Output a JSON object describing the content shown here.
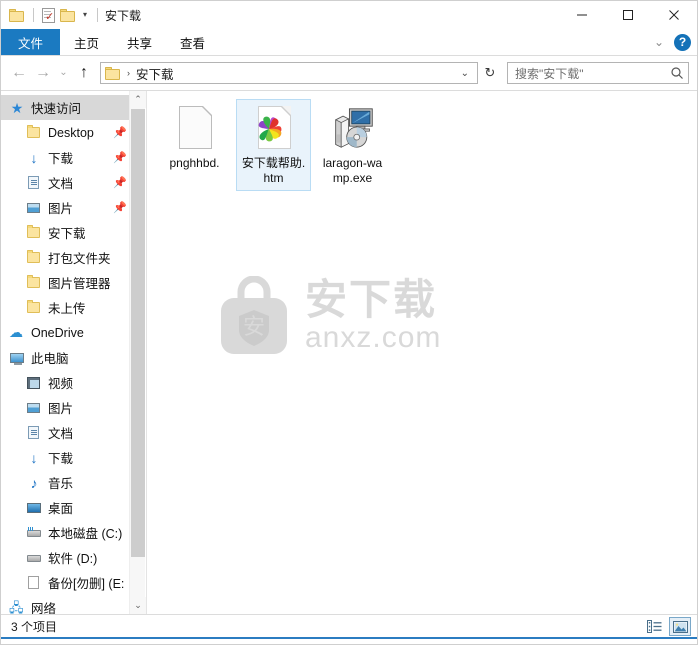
{
  "window": {
    "title": "安下载",
    "quick_access_toolbar": [
      {
        "name": "folder-icon",
        "label": "属性"
      },
      {
        "name": "properties-icon",
        "label": "属性"
      },
      {
        "name": "new-folder-icon",
        "label": "新建文件夹"
      },
      {
        "name": "customize-caret-icon",
        "label": "▾"
      }
    ],
    "controls": {
      "minimize": "—",
      "maximize": "□",
      "close": "✕"
    }
  },
  "ribbon": {
    "tabs": [
      {
        "label": "文件",
        "active": true
      },
      {
        "label": "主页",
        "active": false
      },
      {
        "label": "共享",
        "active": false
      },
      {
        "label": "查看",
        "active": false
      }
    ],
    "collapse_icon": "chevron-down",
    "help_label": "?"
  },
  "navbar": {
    "back_icon": "←",
    "forward_icon": "→",
    "history_icon": "⌄",
    "up_icon": "↑",
    "address": {
      "crumb": "安下载",
      "separator": "›",
      "caret": "⌄"
    },
    "refresh_icon": "↻",
    "search": {
      "placeholder": "搜索\"安下载\"",
      "icon": "search-icon"
    }
  },
  "sidebar": {
    "items": [
      {
        "label": "快速访问",
        "icon": "star-icon",
        "level": 0,
        "selected": true,
        "pinned": false
      },
      {
        "label": "Desktop",
        "icon": "folder-icon",
        "level": 1,
        "selected": false,
        "pinned": true
      },
      {
        "label": "下载",
        "icon": "download-icon",
        "level": 1,
        "selected": false,
        "pinned": true
      },
      {
        "label": "文档",
        "icon": "documents-icon",
        "level": 1,
        "selected": false,
        "pinned": true
      },
      {
        "label": "图片",
        "icon": "pictures-icon",
        "level": 1,
        "selected": false,
        "pinned": true
      },
      {
        "label": "安下载",
        "icon": "folder-icon",
        "level": 1,
        "selected": false,
        "pinned": false
      },
      {
        "label": "打包文件夹",
        "icon": "folder-icon",
        "level": 1,
        "selected": false,
        "pinned": false
      },
      {
        "label": "图片管理器",
        "icon": "folder-icon",
        "level": 1,
        "selected": false,
        "pinned": false
      },
      {
        "label": "未上传",
        "icon": "folder-icon",
        "level": 1,
        "selected": false,
        "pinned": false
      },
      {
        "label": "OneDrive",
        "icon": "cloud-icon",
        "level": 0,
        "selected": false,
        "pinned": false
      },
      {
        "label": "此电脑",
        "icon": "computer-icon",
        "level": 0,
        "selected": false,
        "pinned": false
      },
      {
        "label": "视频",
        "icon": "videos-icon",
        "level": 1,
        "selected": false,
        "pinned": false
      },
      {
        "label": "图片",
        "icon": "pictures-icon",
        "level": 1,
        "selected": false,
        "pinned": false
      },
      {
        "label": "文档",
        "icon": "documents-icon",
        "level": 1,
        "selected": false,
        "pinned": false
      },
      {
        "label": "下载",
        "icon": "download-icon",
        "level": 1,
        "selected": false,
        "pinned": false
      },
      {
        "label": "音乐",
        "icon": "music-icon",
        "level": 1,
        "selected": false,
        "pinned": false
      },
      {
        "label": "桌面",
        "icon": "desktop-icon",
        "level": 1,
        "selected": false,
        "pinned": false
      },
      {
        "label": "本地磁盘 (C:)",
        "icon": "system-drive-icon",
        "level": 1,
        "selected": false,
        "pinned": false
      },
      {
        "label": "软件 (D:)",
        "icon": "drive-icon",
        "level": 1,
        "selected": false,
        "pinned": false
      },
      {
        "label": "备份[勿删] (E:",
        "icon": "file-icon",
        "level": 1,
        "selected": false,
        "pinned": false
      },
      {
        "label": "网络",
        "icon": "network-icon",
        "level": 0,
        "selected": false,
        "pinned": false
      }
    ],
    "scrollbar": {
      "up_icon": "⌃",
      "down_icon": "⌄"
    }
  },
  "files": [
    {
      "name": "pnghhbd.",
      "icon": "blank-document-icon",
      "selected": false
    },
    {
      "name": "安下载帮助.htm",
      "icon": "html-document-icon",
      "selected": true
    },
    {
      "name": "laragon-wamp.exe",
      "icon": "installer-icon",
      "selected": false
    }
  ],
  "watermark": {
    "badge_char": "安",
    "chinese": "安下载",
    "domain": "anxz.com",
    "color": "#d9d9d9"
  },
  "statusbar": {
    "item_count_text": "3 个项目",
    "views": [
      {
        "name": "details-view-button",
        "active": false
      },
      {
        "name": "large-icons-view-button",
        "active": true
      }
    ]
  },
  "colors": {
    "accent": "#1b7ac1",
    "selection_fill": "#e9f3fb",
    "selection_border": "#b9dcf4",
    "sidebar_selected": "#d8d8d8"
  }
}
